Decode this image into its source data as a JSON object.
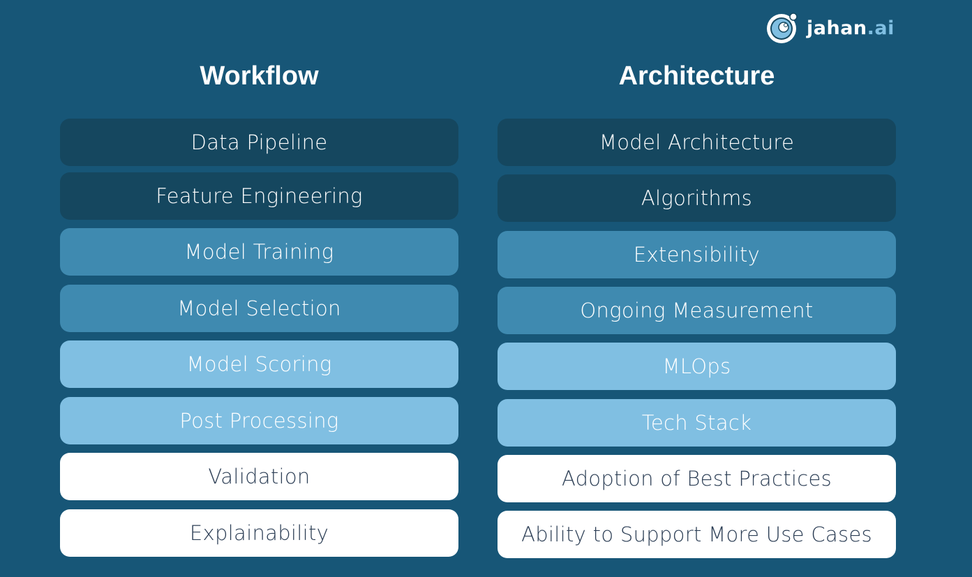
{
  "logo": {
    "name": "jahan",
    "suffix": ".ai"
  },
  "workflow": {
    "title": "Workflow",
    "items": [
      "Data Pipeline",
      "Feature Engineering",
      "Model Training",
      "Model Selection",
      "Model Scoring",
      "Post Processing",
      "Validation",
      "Explainability"
    ]
  },
  "architecture": {
    "title": "Architecture",
    "items": [
      "Model Architecture",
      "Algorithms",
      "Extensibility",
      "Ongoing Measurement",
      "MLOps",
      "Tech Stack",
      "Adoption of Best Practices",
      "Ability to Support More Use Cases"
    ]
  },
  "colors": {
    "background": "#175677",
    "dark": "#15475f",
    "mid": "#3f8ab0",
    "light": "#80bfe2",
    "white": "#ffffff"
  }
}
